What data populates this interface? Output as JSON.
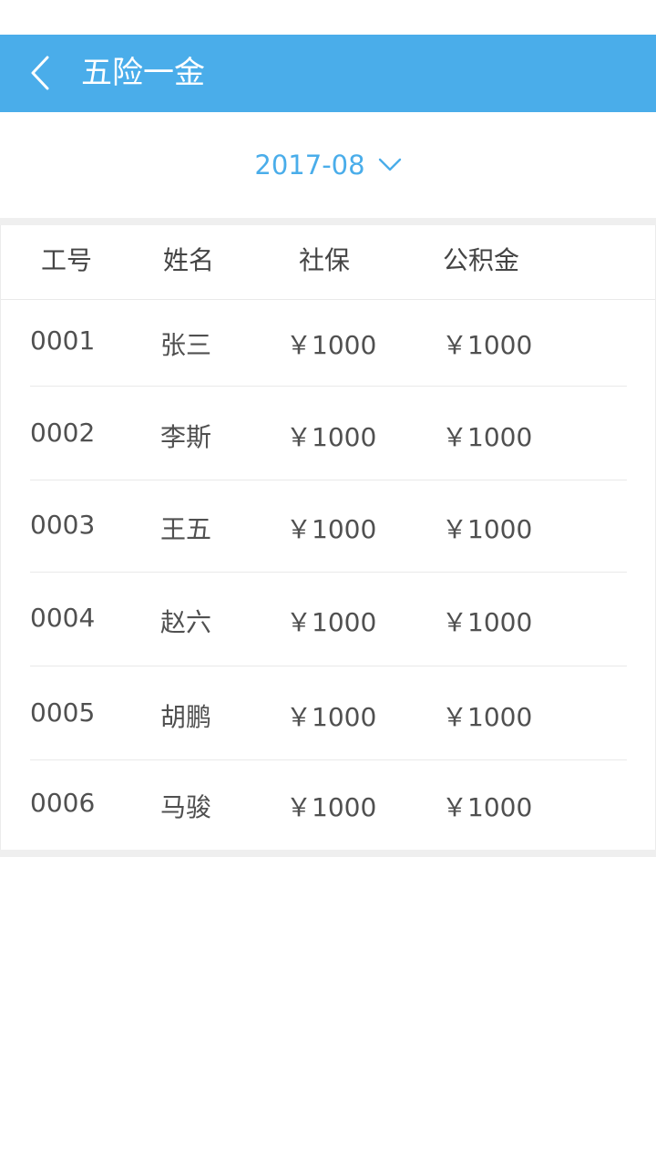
{
  "header": {
    "title": "五险一金",
    "back_icon": "chevron-left-icon",
    "background_color": "#4aadea"
  },
  "month_picker": {
    "value": "2017-08",
    "icon": "chevron-down-icon",
    "color": "#4aadea"
  },
  "table": {
    "columns": [
      "工号",
      "姓名",
      "社保",
      "公积金"
    ],
    "rows": [
      {
        "id": "0001",
        "name": "张三",
        "social": "￥1000",
        "fund": "￥1000"
      },
      {
        "id": "0002",
        "name": "李斯",
        "social": "￥1000",
        "fund": "￥1000"
      },
      {
        "id": "0003",
        "name": "王五",
        "social": "￥1000",
        "fund": "￥1000"
      },
      {
        "id": "0004",
        "name": "赵六",
        "social": "￥1000",
        "fund": "￥1000"
      },
      {
        "id": "0005",
        "name": "胡鹏",
        "social": "￥1000",
        "fund": "￥1000"
      },
      {
        "id": "0006",
        "name": "马骏",
        "social": "￥1000",
        "fund": "￥1000"
      }
    ]
  }
}
